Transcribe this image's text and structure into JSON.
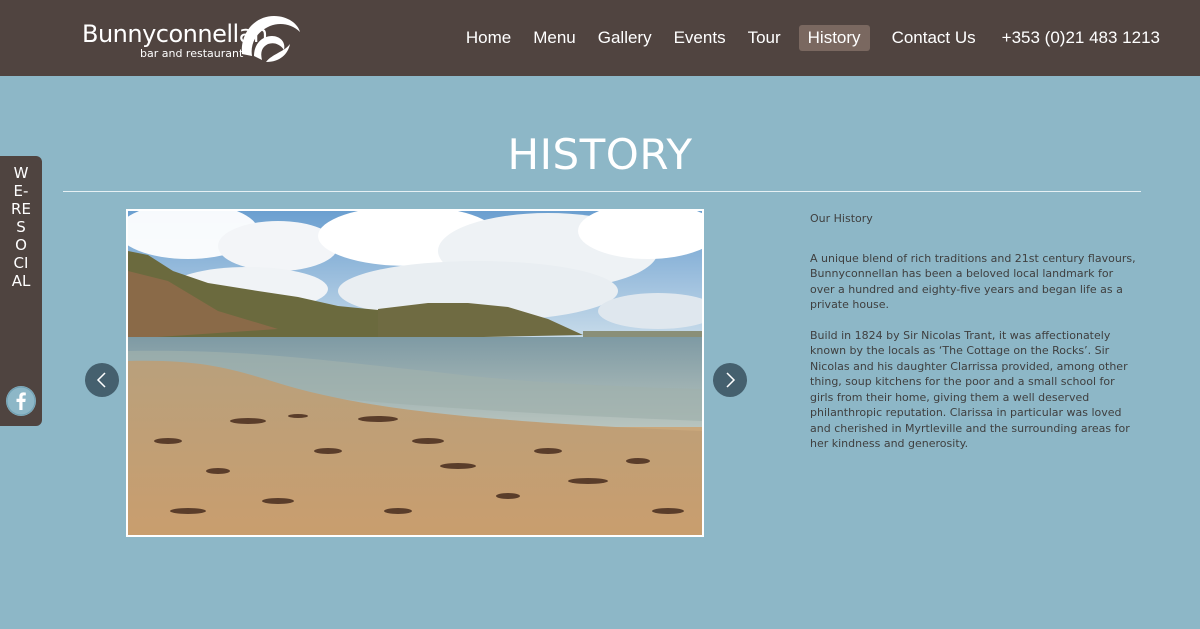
{
  "logo": {
    "name": "Bunnyconnellan",
    "tagline": "bar and restaurant"
  },
  "nav": {
    "items": [
      {
        "label": "Home"
      },
      {
        "label": "Menu"
      },
      {
        "label": "Gallery"
      },
      {
        "label": "Events"
      },
      {
        "label": "Tour"
      },
      {
        "label": "History",
        "active": true
      },
      {
        "label": "Contact Us"
      }
    ],
    "phone": "+353 (0)21 483 1213"
  },
  "social": {
    "label": "WE-RE SOCIAL",
    "icon": "facebook-icon"
  },
  "page": {
    "title": "HISTORY"
  },
  "gallery": {
    "prev_icon": "chevron-left-icon",
    "next_icon": "chevron-right-icon"
  },
  "history": {
    "heading": "Our History",
    "paragraph1": "A unique blend of  rich traditions and 21st century flavours, Bunnyconnellan has been a beloved local landmark for over a hundred and eighty-five years and began life as a private house.",
    "paragraph2": "Build in 1824 by Sir Nicolas Trant, it was affectionately known by the locals as ‘The Cottage on the Rocks’. Sir Nicolas and his daughter Clarrissa provided, among other thing, soup kitchens for the poor and a small school for girls from their home, giving them a well deserved philanthropic reputation. Clarissa in particular was loved and cherished in Myrtleville and the surrounding areas for her kindness and generosity."
  },
  "colors": {
    "header_bg": "#504440",
    "page_bg": "#8db7c7",
    "active_nav_bg": "#7a6860",
    "arrow_bg": "#45606e"
  }
}
